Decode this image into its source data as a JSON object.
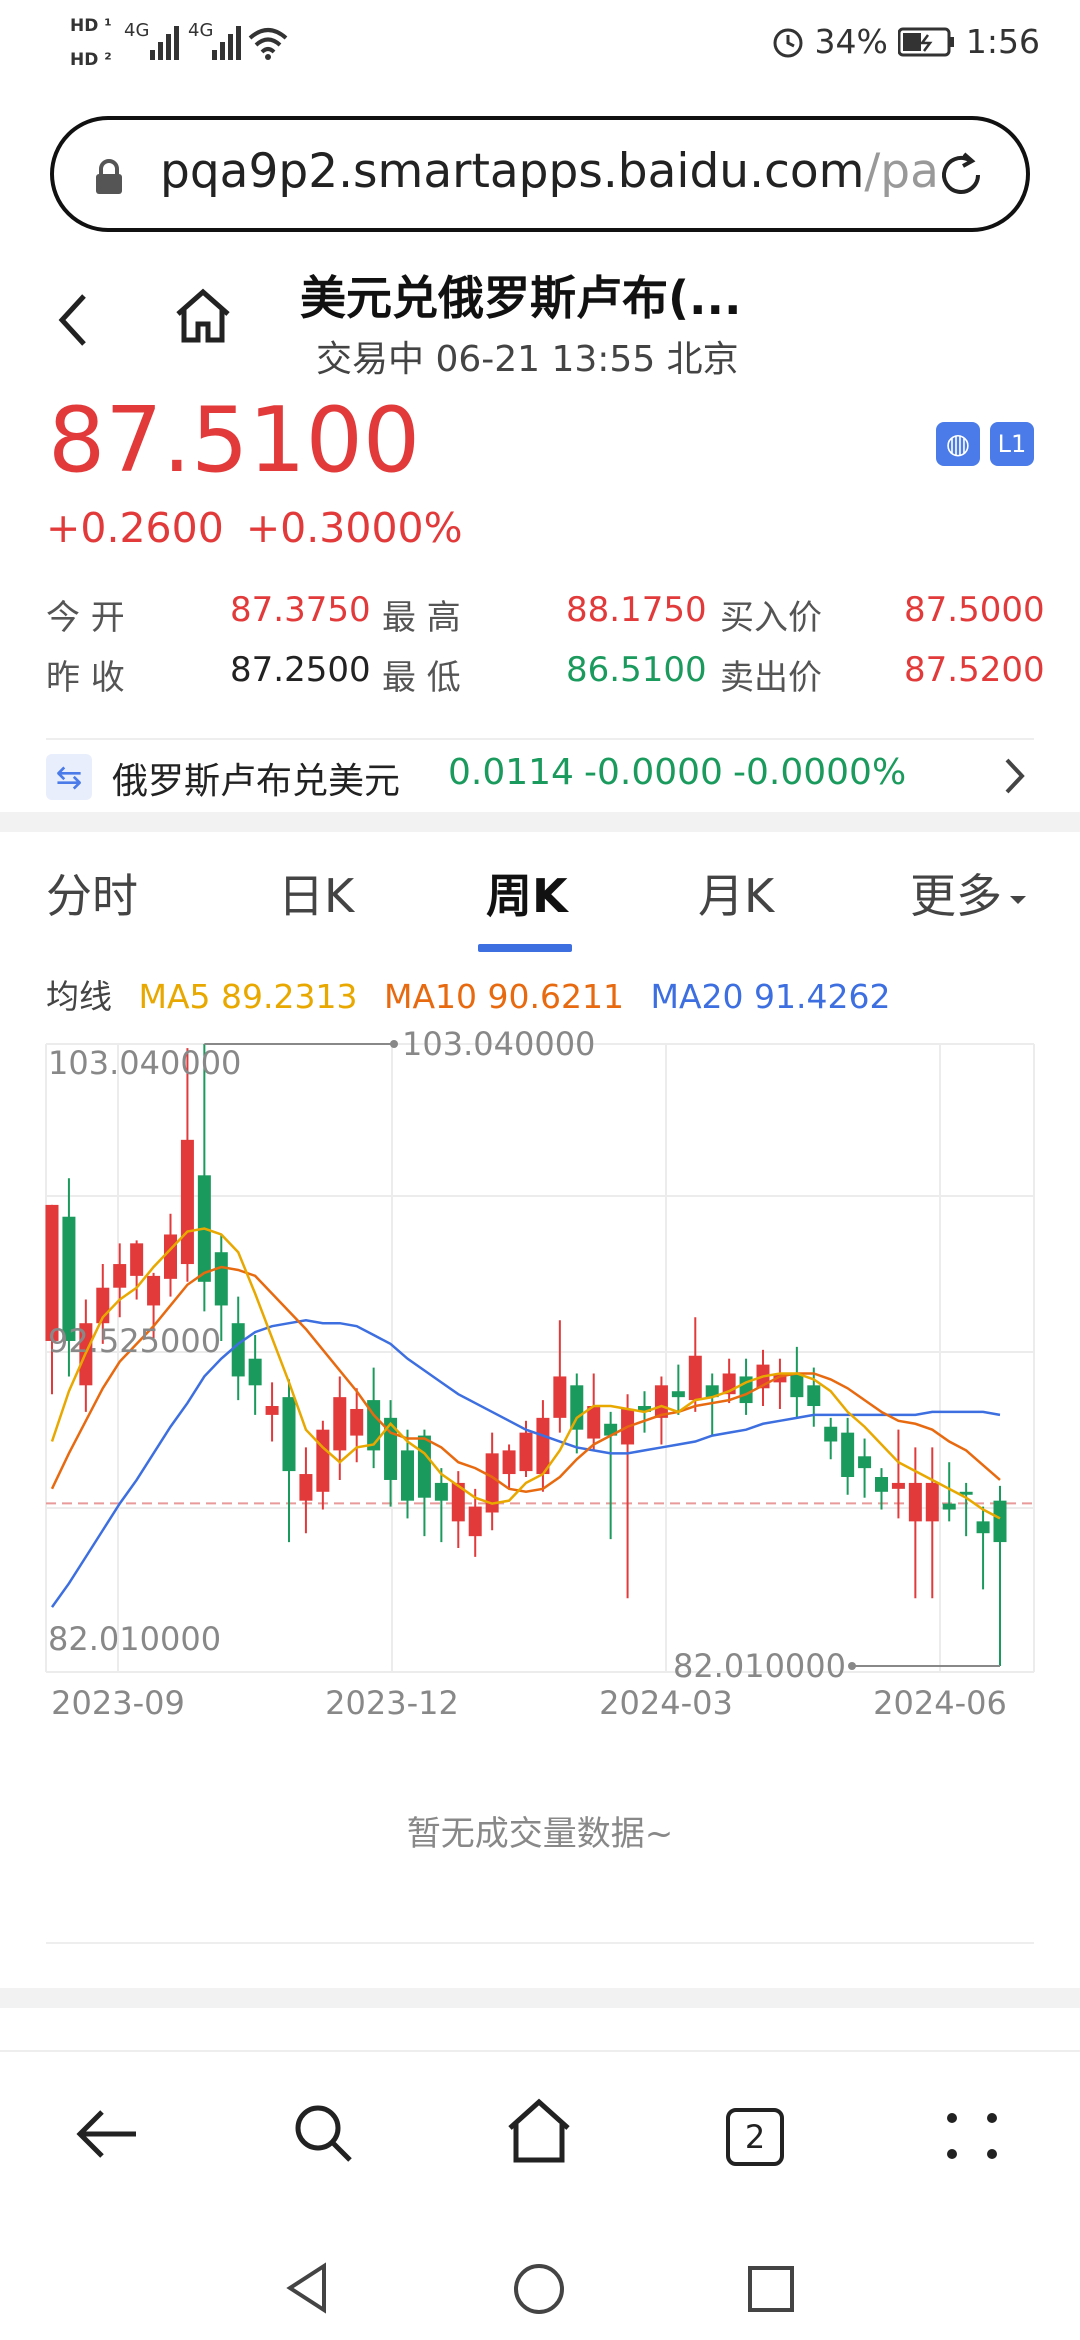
{
  "status_bar": {
    "network_1": "4G",
    "network_2": "4G",
    "battery": "34%",
    "time": "1:56"
  },
  "url_bar": {
    "url_main": "pqa9p2.smartapps.baidu.com",
    "url_tail": "/pag"
  },
  "header": {
    "title": "美元兑俄罗斯卢布(...",
    "subtitle": "交易中 06-21 13:55 北京"
  },
  "quote": {
    "price": "87.5100",
    "change": "+0.2600",
    "change_pct": "+0.3000%",
    "badge_l1": "L1",
    "rows": [
      {
        "l1": "今  开",
        "v1": "87.3750",
        "l2": "最  高",
        "v2": "88.1750",
        "l3": "买入价",
        "v3": "87.5000"
      },
      {
        "l1": "昨  收",
        "v1": "87.2500",
        "l2": "最  低",
        "v2": "86.5100",
        "l3": "卖出价",
        "v3": "87.5200"
      }
    ]
  },
  "reverse_pair": {
    "name": "俄罗斯卢布兑美元",
    "price": "0.0114",
    "change": "-0.0000",
    "change_pct": "-0.0000%"
  },
  "tabs": [
    "分时",
    "日K",
    "周K",
    "月K",
    "更多"
  ],
  "active_tab": "周K",
  "ma_legend": {
    "label": "均线",
    "ma5": "MA5 89.2313",
    "ma10": "MA10 90.6211",
    "ma20": "MA20 91.4262"
  },
  "colors": {
    "up": "#e23a3a",
    "down": "#1a9a5c",
    "ma5": "#e8a800",
    "ma10": "#e86a10",
    "ma20": "#3d6fe0",
    "accent": "#3d6fe0"
  },
  "chart_data": {
    "type": "candlestick",
    "y_labels": [
      "103.040000",
      "92.525000",
      "82.010000"
    ],
    "x_labels": [
      "2023-09",
      "2023-12",
      "2024-03",
      "2024-06"
    ],
    "ylim": [
      82.01,
      103.04
    ],
    "high_marker": "103.040000",
    "low_marker": "82.010000",
    "current_price_line": 87.51,
    "candles": [
      {
        "o": 93.0,
        "c": 97.6,
        "h": 97.6,
        "l": 91.2
      },
      {
        "o": 97.2,
        "c": 93.0,
        "h": 98.5,
        "l": 91.8
      },
      {
        "o": 91.5,
        "c": 93.6,
        "h": 94.4,
        "l": 90.6
      },
      {
        "o": 93.6,
        "c": 94.8,
        "h": 95.6,
        "l": 92.9
      },
      {
        "o": 94.8,
        "c": 95.6,
        "h": 96.3,
        "l": 93.8
      },
      {
        "o": 95.2,
        "c": 96.3,
        "h": 96.4,
        "l": 94.4
      },
      {
        "o": 94.2,
        "c": 95.2,
        "h": 95.3,
        "l": 93.1
      },
      {
        "o": 95.1,
        "c": 96.6,
        "h": 97.3,
        "l": 94.5
      },
      {
        "o": 95.6,
        "c": 99.8,
        "h": 102.9,
        "l": 95.0
      },
      {
        "o": 98.6,
        "c": 95.0,
        "h": 103.04,
        "l": 94.0
      },
      {
        "o": 96.0,
        "c": 94.2,
        "h": 96.6,
        "l": 93.0
      },
      {
        "o": 93.6,
        "c": 91.8,
        "h": 94.5,
        "l": 91.0
      },
      {
        "o": 92.4,
        "c": 91.5,
        "h": 93.2,
        "l": 90.5
      },
      {
        "o": 90.5,
        "c": 90.8,
        "h": 91.6,
        "l": 89.6
      },
      {
        "o": 91.1,
        "c": 88.6,
        "h": 91.7,
        "l": 86.2
      },
      {
        "o": 87.6,
        "c": 88.5,
        "h": 89.4,
        "l": 86.5
      },
      {
        "o": 87.9,
        "c": 90.0,
        "h": 90.3,
        "l": 87.3
      },
      {
        "o": 89.3,
        "c": 91.1,
        "h": 91.8,
        "l": 88.3
      },
      {
        "o": 89.8,
        "c": 90.7,
        "h": 91.4,
        "l": 88.9
      },
      {
        "o": 91.0,
        "c": 89.3,
        "h": 92.1,
        "l": 88.7
      },
      {
        "o": 90.4,
        "c": 88.3,
        "h": 91.0,
        "l": 87.4
      },
      {
        "o": 89.3,
        "c": 87.6,
        "h": 90.0,
        "l": 87.0
      },
      {
        "o": 89.8,
        "c": 87.7,
        "h": 90.0,
        "l": 86.4
      },
      {
        "o": 88.2,
        "c": 87.6,
        "h": 88.7,
        "l": 86.2
      },
      {
        "o": 86.9,
        "c": 88.2,
        "h": 88.6,
        "l": 86.0
      },
      {
        "o": 86.4,
        "c": 87.4,
        "h": 88.0,
        "l": 85.7
      },
      {
        "o": 87.2,
        "c": 89.2,
        "h": 89.9,
        "l": 86.6
      },
      {
        "o": 88.5,
        "c": 89.3,
        "h": 89.5,
        "l": 88.0
      },
      {
        "o": 88.6,
        "c": 89.9,
        "h": 90.3,
        "l": 88.4
      },
      {
        "o": 88.5,
        "c": 90.4,
        "h": 91.0,
        "l": 87.9
      },
      {
        "o": 90.4,
        "c": 91.8,
        "h": 93.7,
        "l": 89.9
      },
      {
        "o": 91.5,
        "c": 90.0,
        "h": 91.9,
        "l": 89.2
      },
      {
        "o": 89.7,
        "c": 90.8,
        "h": 91.9,
        "l": 89.3
      },
      {
        "o": 90.2,
        "c": 89.8,
        "h": 90.6,
        "l": 86.3
      },
      {
        "o": 89.5,
        "c": 90.7,
        "h": 91.2,
        "l": 84.3
      },
      {
        "o": 90.8,
        "c": 90.6,
        "h": 91.3,
        "l": 89.9
      },
      {
        "o": 90.4,
        "c": 91.5,
        "h": 91.8,
        "l": 89.5
      },
      {
        "o": 91.3,
        "c": 91.1,
        "h": 92.2,
        "l": 90.5
      },
      {
        "o": 91.0,
        "c": 92.5,
        "h": 93.8,
        "l": 90.6
      },
      {
        "o": 91.5,
        "c": 91.1,
        "h": 91.9,
        "l": 89.8
      },
      {
        "o": 91.2,
        "c": 91.9,
        "h": 92.4,
        "l": 90.9
      },
      {
        "o": 91.8,
        "c": 90.9,
        "h": 92.4,
        "l": 90.5
      },
      {
        "o": 91.4,
        "c": 92.2,
        "h": 92.7,
        "l": 90.8
      },
      {
        "o": 91.6,
        "c": 91.9,
        "h": 92.4,
        "l": 90.7
      },
      {
        "o": 91.9,
        "c": 91.1,
        "h": 92.8,
        "l": 90.4
      },
      {
        "o": 91.5,
        "c": 90.8,
        "h": 92.1,
        "l": 90.1
      },
      {
        "o": 90.1,
        "c": 89.6,
        "h": 90.4,
        "l": 89.0
      },
      {
        "o": 89.9,
        "c": 88.4,
        "h": 90.4,
        "l": 87.8
      },
      {
        "o": 89.1,
        "c": 88.7,
        "h": 89.7,
        "l": 87.7
      },
      {
        "o": 88.4,
        "c": 87.9,
        "h": 88.7,
        "l": 87.3
      },
      {
        "o": 88.0,
        "c": 88.2,
        "h": 90.0,
        "l": 87.0
      },
      {
        "o": 86.9,
        "c": 88.2,
        "h": 89.4,
        "l": 84.3
      },
      {
        "o": 86.9,
        "c": 88.2,
        "h": 89.4,
        "l": 84.3
      },
      {
        "o": 87.5,
        "c": 87.3,
        "h": 88.9,
        "l": 86.9
      },
      {
        "o": 87.9,
        "c": 87.8,
        "h": 88.2,
        "l": 86.4
      },
      {
        "o": 86.9,
        "c": 86.5,
        "h": 87.4,
        "l": 84.6
      },
      {
        "o": 87.6,
        "c": 86.2,
        "h": 88.1,
        "l": 82.01
      }
    ],
    "ma5": [
      89.6,
      91.3,
      92.6,
      93.8,
      94.4,
      94.8,
      95.5,
      96.1,
      96.7,
      96.8,
      96.6,
      96.0,
      94.6,
      93.1,
      91.6,
      90.0,
      89.4,
      88.9,
      89.4,
      89.5,
      90.2,
      89.6,
      89.2,
      88.5,
      88.1,
      87.7,
      87.5,
      87.6,
      88.2,
      88.5,
      89.3,
      90.4,
      90.8,
      90.8,
      90.7,
      90.6,
      90.8,
      90.6,
      91.0,
      91.1,
      91.3,
      91.6,
      91.8,
      91.9,
      91.9,
      91.7,
      91.3,
      90.6,
      90.1,
      89.5,
      88.9,
      88.6,
      88.3,
      88.0,
      87.7,
      87.3,
      87.0
    ],
    "ma10": [
      88.0,
      89.2,
      90.3,
      91.4,
      92.3,
      92.9,
      93.5,
      94.2,
      94.9,
      95.3,
      95.5,
      95.4,
      95.2,
      94.6,
      94.0,
      93.4,
      92.7,
      92.0,
      91.3,
      90.5,
      89.9,
      89.7,
      89.7,
      89.4,
      88.9,
      88.7,
      88.4,
      88.0,
      87.9,
      88.0,
      88.4,
      89.0,
      89.5,
      89.8,
      90.1,
      90.3,
      90.5,
      90.6,
      90.8,
      90.9,
      91.0,
      91.2,
      91.5,
      91.8,
      91.9,
      91.9,
      91.7,
      91.4,
      91.0,
      90.6,
      90.3,
      90.2,
      90.0,
      89.6,
      89.3,
      88.8,
      88.3
    ],
    "ma20": [
      84.0,
      84.8,
      85.7,
      86.6,
      87.5,
      88.3,
      89.2,
      90.1,
      90.9,
      91.8,
      92.4,
      92.9,
      93.3,
      93.5,
      93.6,
      93.7,
      93.6,
      93.6,
      93.5,
      93.2,
      92.9,
      92.4,
      92.0,
      91.6,
      91.2,
      90.9,
      90.6,
      90.3,
      90.0,
      89.8,
      89.6,
      89.4,
      89.3,
      89.2,
      89.2,
      89.3,
      89.4,
      89.5,
      89.6,
      89.8,
      89.9,
      90.0,
      90.2,
      90.3,
      90.4,
      90.5,
      90.5,
      90.5,
      90.5,
      90.5,
      90.5,
      90.5,
      90.6,
      90.6,
      90.6,
      90.6,
      90.5
    ]
  },
  "volume_empty_text": "暂无成交量数据~"
}
